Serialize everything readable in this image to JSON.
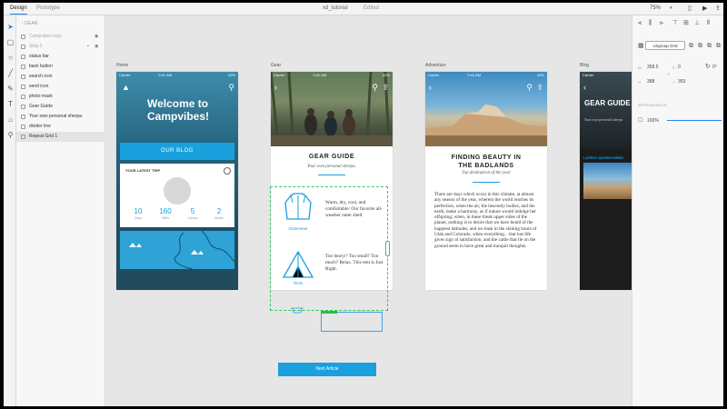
{
  "titlebar": {
    "tabs": [
      "Design",
      "Prototype"
    ],
    "doc_title": "xd_tutorial",
    "doc_status": "Edited",
    "zoom": "75%"
  },
  "tools": [
    "select-icon",
    "rectangle-icon",
    "ellipse-icon",
    "line-icon",
    "pen-icon",
    "text-icon",
    "artboard-icon",
    "zoom-icon"
  ],
  "layers": {
    "back_label": "GEAR",
    "items": [
      {
        "label": "Campvibes logo",
        "dim": true
      },
      {
        "label": "Step 3",
        "dim": true
      },
      {
        "label": "status bar",
        "dim": false
      },
      {
        "label": "back button",
        "dim": false
      },
      {
        "label": "search icon",
        "dim": false
      },
      {
        "label": "send icon",
        "dim": false
      },
      {
        "label": "photo mask",
        "dim": false
      },
      {
        "label": "Gear Guide",
        "dim": false
      },
      {
        "label": "Your own personal sherpa.",
        "dim": false
      },
      {
        "label": "divider line",
        "dim": false
      },
      {
        "label": "Repeat Grid 1",
        "dim": false,
        "selected": true
      }
    ]
  },
  "artboards": {
    "home": {
      "label": "Home",
      "carrier": "Carrier",
      "time": "9:41 AM",
      "battery": "42%",
      "title": "Welcome to Campvibes!",
      "cta": "OUR BLOG",
      "trip_card_title": "YOUR LATEST TRIP",
      "stats": [
        {
          "value": "10",
          "label": "Days"
        },
        {
          "value": "160",
          "label": "Miles"
        },
        {
          "value": "5",
          "label": "Camps"
        },
        {
          "value": "2",
          "label": "Bears"
        }
      ]
    },
    "gear": {
      "label": "Gear",
      "carrier": "Carrier",
      "time": "9:41 AM",
      "battery": "42%",
      "title": "GEAR GUIDE",
      "subtitle": "Your own personal sherpa.",
      "items": [
        {
          "label": "Outerwear",
          "text": "Warm, dry, cool, and comfortable: Our favorite all-weather outer shell."
        },
        {
          "label": "Tents",
          "text": "Too heavy? Too small? Too much? Relax. This tent is Just Right."
        }
      ]
    },
    "badlands": {
      "label": "Adventure",
      "carrier": "Carrier",
      "time": "9:41 AM",
      "battery": "42%",
      "title": "FINDING BEAUTY IN THE BADLANDS",
      "subtitle": "Top destination of the year",
      "body": "There are days which occur in this climate, at almost any season of the year, wherein the world reaches its perfection, when the air, the heavenly bodies, and the earth, make a harmony, as if nature would indulge her offspring; when, in these bleak upper sides of the planet, nothing is to desire that we have heard of the happiest latitudes, and we bask in the shining hours of Utah and Colorado, when everything... that has life gives sign of satisfaction, and the cattle that lie on the ground seem to have great and tranquil thoughts."
    },
    "blog": {
      "label": "Blog",
      "carrier": "Carrier",
      "hero_title": "GEAR GUIDE",
      "hero_small": "Your own personal sherpa.",
      "section": "LATEST ADVENTURES"
    }
  },
  "next_button": "Next Article",
  "properties": {
    "ungroup_label": "Ungroup Grid",
    "w": "358.5",
    "x": "0",
    "h": "388",
    "y": "353",
    "rotation": "0°",
    "appearance_label": "APPEARANCE",
    "opacity": "100%"
  },
  "colors": {
    "accent": "#1aa0dc",
    "selection_green": "#36c36b",
    "selection_blue": "#4b9be0"
  }
}
